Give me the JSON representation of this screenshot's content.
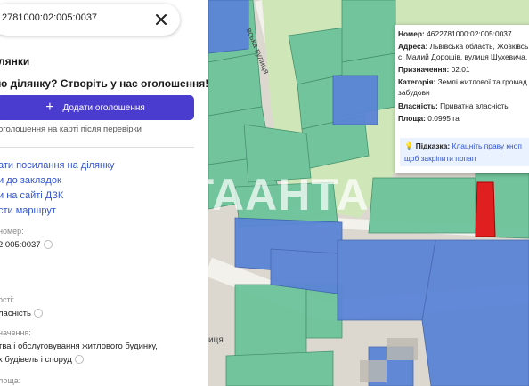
{
  "search": {
    "value": "2781000:02:005:0037"
  },
  "panel": {
    "heading": "лянки",
    "cta_text": "ю ділянку? Створіть у нас оголошення!",
    "add_button_label": "Додати оголошення",
    "verify_note": "оголошення на карті після перевірки",
    "actions": [
      "ати посилання на ділянку",
      "и до закладок",
      "и на сайті ДЗК",
      "сти маршрут"
    ],
    "cadastral_label": "номер:",
    "cadastral_value": "2:005:0037",
    "ownership_label": "ості:",
    "ownership_value": "ласність",
    "purpose_label": "начення:",
    "purpose_value_1": "тва і обслуговування житлового будинку,",
    "purpose_value_2": "х будівель і споруд",
    "area_label": "лоща:"
  },
  "map": {
    "street_label_1": "вська вулиця",
    "street_label_2": "иця"
  },
  "popup": {
    "number_label": "Номер:",
    "number_value": "4622781000:02:005:0037",
    "address_label": "Адреса:",
    "address_value_1": "Львівська область, Жовківсь",
    "address_value_2": "с. Малий Дорошів, вулиця Шухевича,",
    "purpose_label": "Призначення:",
    "purpose_value": "02.01",
    "category_label": "Категорія:",
    "category_value_1": "Землі житлової та громад",
    "category_value_2": "забудови",
    "ownership_label": "Власність:",
    "ownership_value": "Приватна власність",
    "area_label": "Площа:",
    "area_value": "0.0995 га",
    "hint_label": "Підказка:",
    "hint_text_1": "Клацніть праву кноп",
    "hint_text_2": "щоб закріпити попап"
  },
  "watermark": "АТААНТА",
  "colors": {
    "accent": "#4a3ccf",
    "parcel_green": "#6cc39a",
    "parcel_blue": "#5b84d6",
    "selected": "#e02020"
  }
}
